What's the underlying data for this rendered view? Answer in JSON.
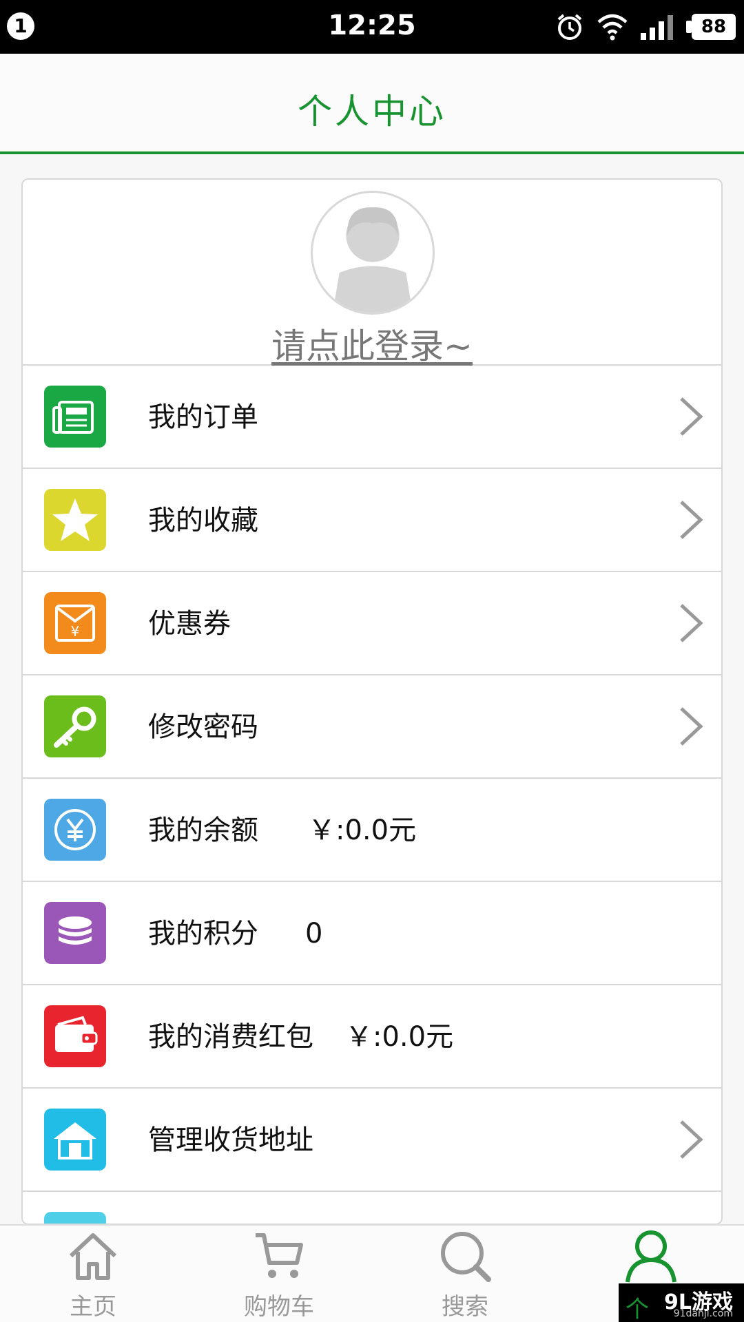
{
  "status_bar": {
    "notification_count": "1",
    "time": "12:25",
    "battery": "88",
    "icons": [
      "alarm-icon",
      "wifi-icon",
      "signal-icon",
      "battery-icon"
    ]
  },
  "header": {
    "title": "个人中心"
  },
  "profile": {
    "login_text": "请点此登录~",
    "avatar_icon": "default-avatar-icon"
  },
  "menu": {
    "orders": {
      "label": "我的订单",
      "icon": "order-list-icon",
      "color": "#1aa844"
    },
    "favorites": {
      "label": "我的收藏",
      "icon": "star-icon",
      "color": "#dcd72e"
    },
    "coupons": {
      "label": "优惠券",
      "icon": "coupon-envelope-icon",
      "color": "#f28a1c"
    },
    "password": {
      "label": "修改密码",
      "icon": "key-icon",
      "color": "#6bbd1c"
    },
    "balance": {
      "label": "我的余额",
      "value": "￥:0.0元",
      "icon": "yuan-coin-icon",
      "color": "#4fa8e6"
    },
    "points": {
      "label": "我的积分",
      "value": "0",
      "icon": "coin-stack-icon",
      "color": "#9b57b8"
    },
    "red_packet": {
      "label": "我的消费红包",
      "value": "￥:0.0元",
      "icon": "wallet-icon",
      "color": "#e8252f"
    },
    "address": {
      "label": "管理收货地址",
      "icon": "house-icon",
      "color": "#22bde6"
    }
  },
  "bottom_nav": {
    "home": {
      "label": "主页",
      "icon": "home-icon"
    },
    "cart": {
      "label": "购物车",
      "icon": "cart-icon"
    },
    "search": {
      "label": "搜索",
      "icon": "search-icon"
    },
    "profile": {
      "icon": "user-icon",
      "active_color": "#17932f"
    }
  },
  "watermark": {
    "main": "9L游戏",
    "sub": "91danji.com",
    "arrow": "个"
  }
}
